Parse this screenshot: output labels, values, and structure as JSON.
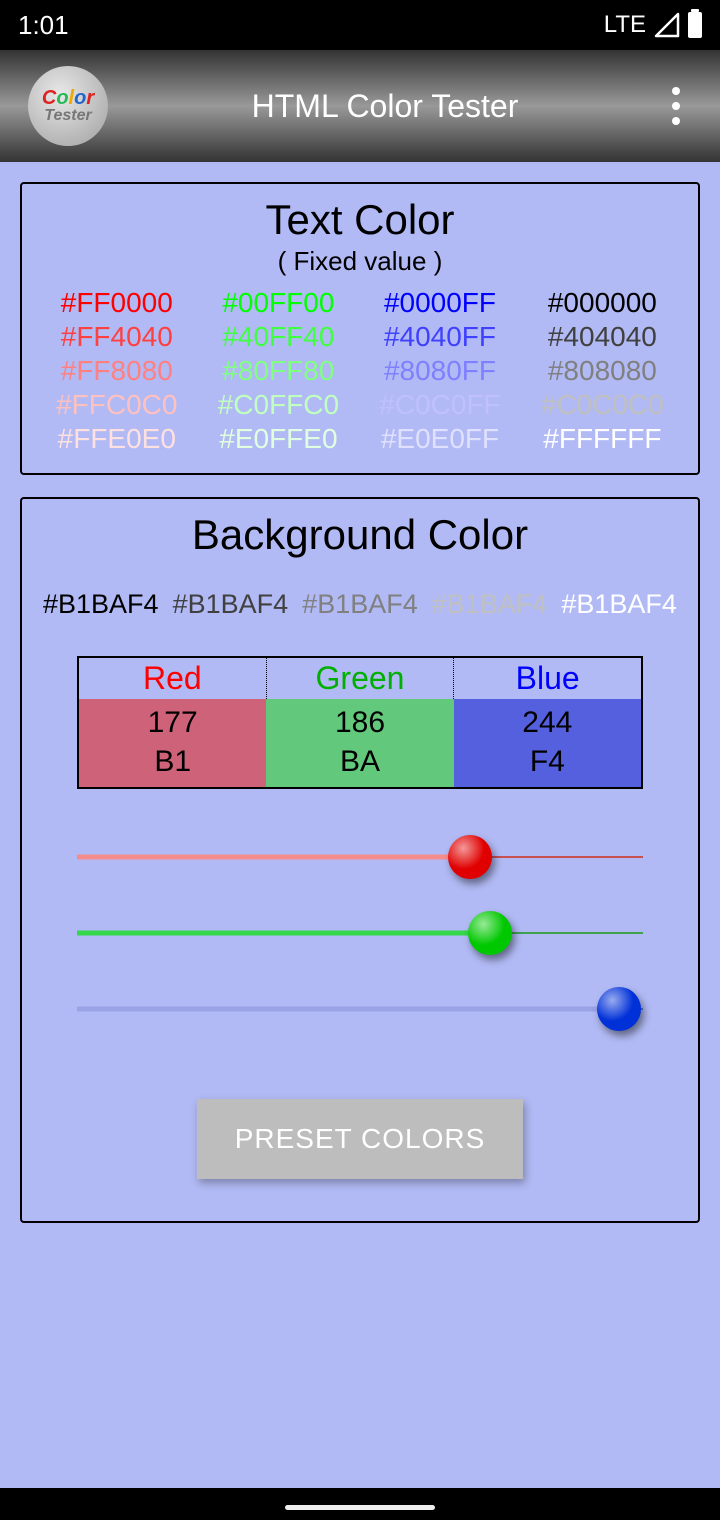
{
  "status": {
    "time": "1:01",
    "net": "LTE"
  },
  "titlebar": {
    "title": "HTML Color Tester",
    "logo_word1_letters": [
      "C",
      "o",
      "l",
      "o",
      "r"
    ],
    "logo_word2": "Tester"
  },
  "text_color_panel": {
    "title": "Text Color",
    "subtitle": "( Fixed value )",
    "columns": [
      [
        "#FF0000",
        "#FF4040",
        "#FF8080",
        "#FFC0C0",
        "#FFE0E0"
      ],
      [
        "#00FF00",
        "#40FF40",
        "#80FF80",
        "#C0FFC0",
        "#E0FFE0"
      ],
      [
        "#0000FF",
        "#4040FF",
        "#8080FF",
        "#C0C0FF",
        "#E0E0FF"
      ],
      [
        "#000000",
        "#404040",
        "#808080",
        "#C0C0C0",
        "#FFFFFF"
      ]
    ]
  },
  "bg_panel": {
    "title": "Background Color",
    "hex_repeat": "#B1BAF4",
    "hex_shades": [
      "#000000",
      "#404040",
      "#808080",
      "#C0C0C0",
      "#FFFFFF"
    ],
    "table": {
      "headers": [
        {
          "label": "Red",
          "color": "#FF0000"
        },
        {
          "label": "Green",
          "color": "#00B000"
        },
        {
          "label": "Blue",
          "color": "#0000FF"
        }
      ],
      "cells": [
        {
          "dec": "177",
          "hex": "B1",
          "bg": "#CD6279"
        },
        {
          "dec": "186",
          "hex": "BA",
          "bg": "#62C87C"
        },
        {
          "dec": "244",
          "hex": "F4",
          "bg": "#5560DE"
        }
      ]
    },
    "sliders": [
      {
        "name": "red",
        "value": 177,
        "max": 255,
        "fill": "#F58C8C",
        "rest": "#C85050",
        "thumb": "#E00000"
      },
      {
        "name": "green",
        "value": 186,
        "max": 255,
        "fill": "#34D84A",
        "rest": "#3FA24F",
        "thumb": "#00C800"
      },
      {
        "name": "blue",
        "value": 244,
        "max": 255,
        "fill": "#9AA2E8",
        "rest": "#6B73C7",
        "thumb": "#0030D8"
      }
    ],
    "preset_button": "PRESET COLORS"
  }
}
